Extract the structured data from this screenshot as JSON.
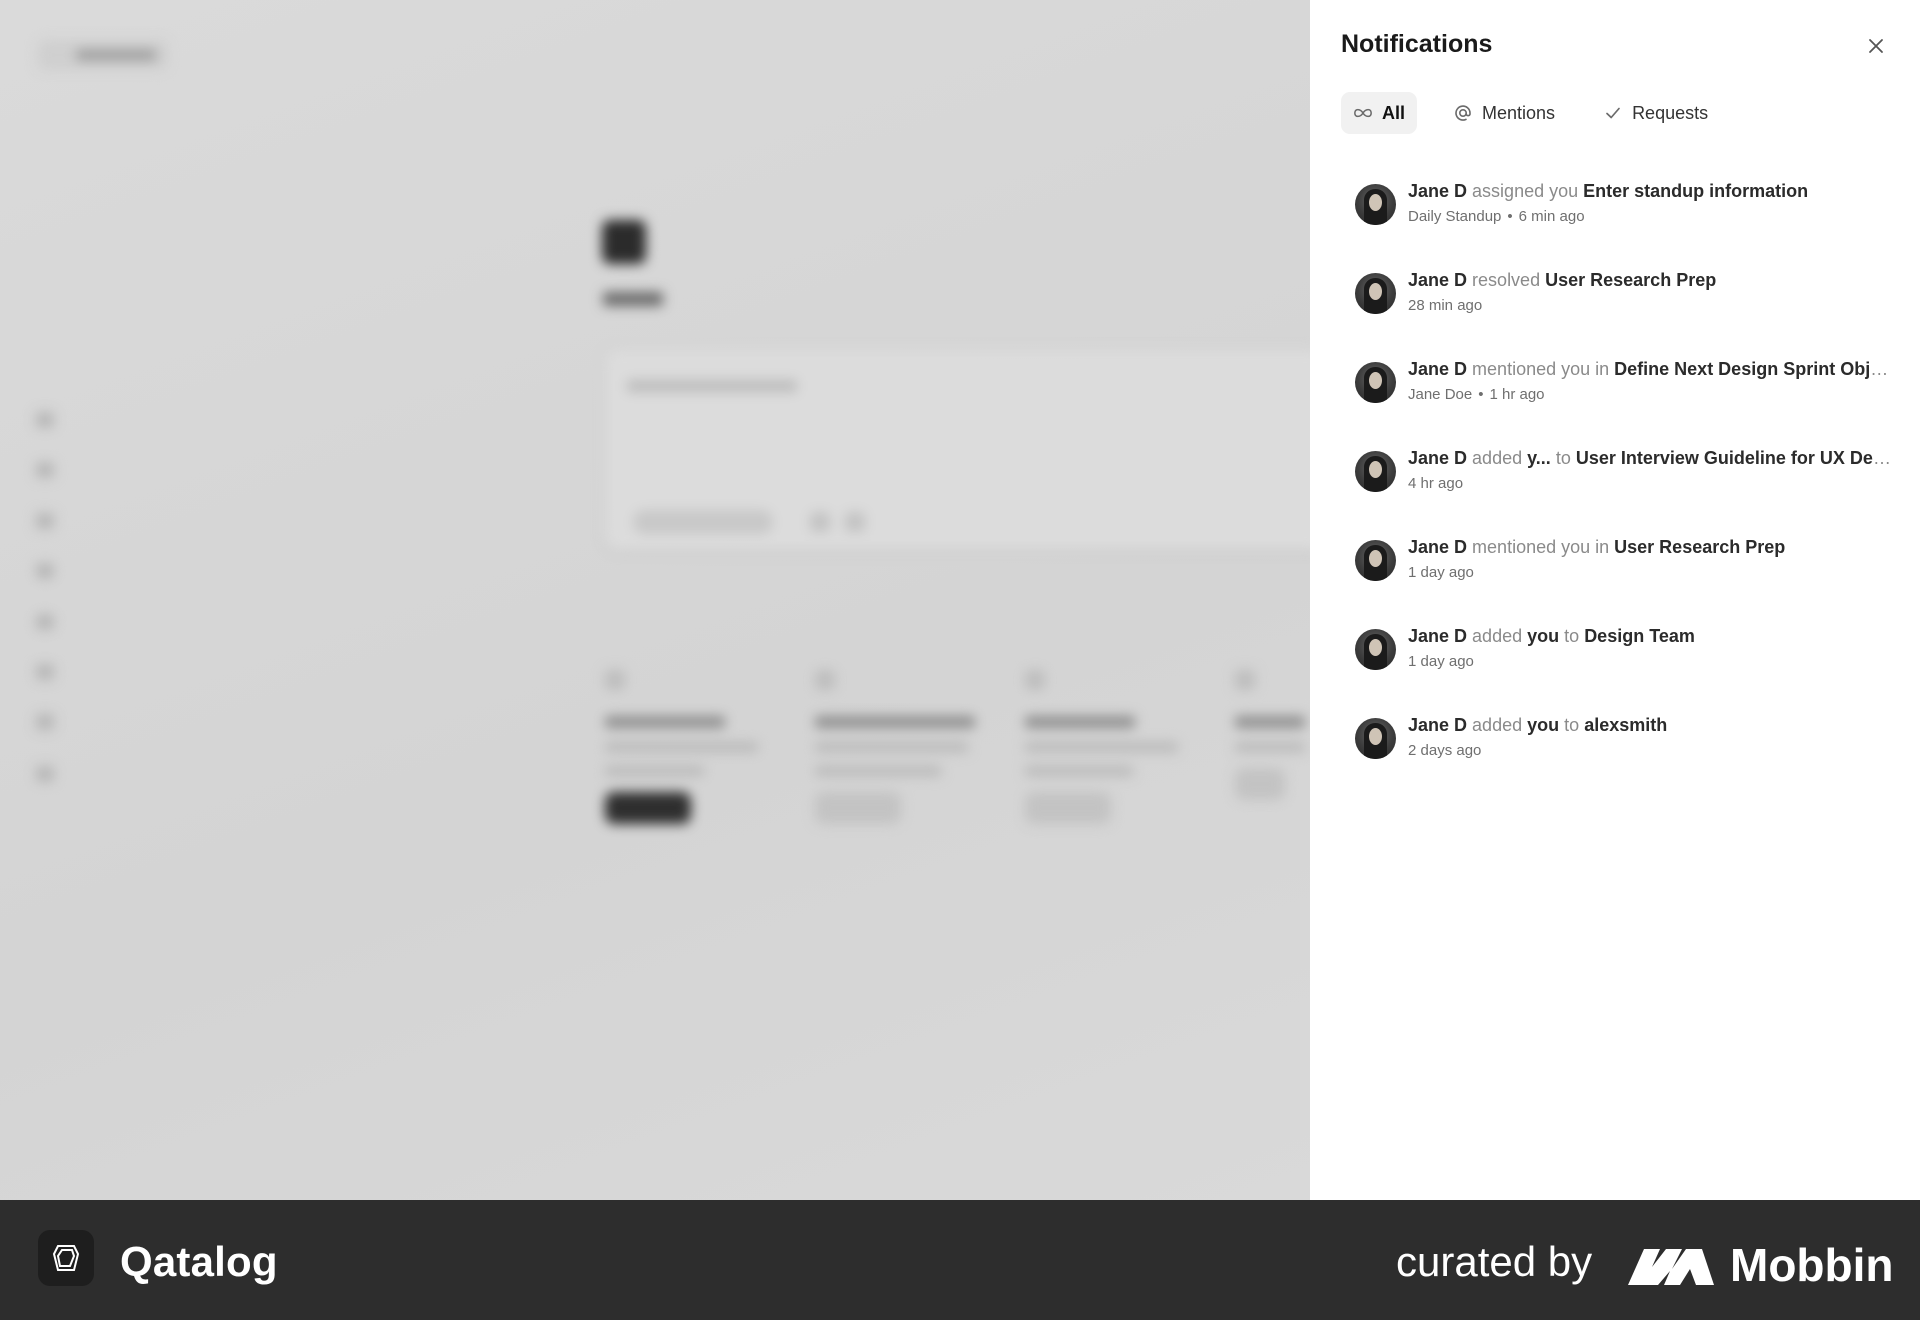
{
  "panel": {
    "title": "Notifications",
    "tabs": [
      {
        "label": "All",
        "icon": "infinity-icon",
        "active": true
      },
      {
        "label": "Mentions",
        "icon": "at-icon",
        "active": false
      },
      {
        "label": "Requests",
        "icon": "check-icon",
        "active": false
      }
    ],
    "notifications": [
      {
        "actor": "Jane D",
        "action": "assigned you",
        "sub": "",
        "pre": "",
        "target": "Enter standup information",
        "context": "Daily Standup",
        "time": "6 min ago"
      },
      {
        "actor": "Jane D",
        "action": "resolved",
        "sub": "",
        "pre": "",
        "target": "User Research Prep",
        "context": "",
        "time": "28 min ago"
      },
      {
        "actor": "Jane D",
        "action": "mentioned you in",
        "sub": "",
        "pre": "",
        "target": "Define Next Design Sprint Obje...",
        "context": "Jane Doe",
        "time": "1 hr ago"
      },
      {
        "actor": "Jane D",
        "action": "added",
        "sub": "y...",
        "pre": "to",
        "target": "User Interview Guideline for UX Desi...",
        "context": "",
        "time": "4 hr ago"
      },
      {
        "actor": "Jane D",
        "action": "mentioned you in",
        "sub": "",
        "pre": "",
        "target": "User Research Prep",
        "context": "",
        "time": "1 day ago"
      },
      {
        "actor": "Jane D",
        "action": "added",
        "sub": "you",
        "pre": "to",
        "target": "Design Team",
        "context": "",
        "time": "1 day ago"
      },
      {
        "actor": "Jane D",
        "action": "added",
        "sub": "you",
        "pre": "to",
        "target": "alexsmith",
        "context": "",
        "time": "2 days ago"
      }
    ]
  },
  "footer": {
    "app_name": "Qatalog",
    "curated_by": "curated by",
    "brand": "Mobbin"
  },
  "colors": {
    "panel_bg": "#ffffff",
    "overlay_bg": "#d9d9d9",
    "footer_bg": "#2d2d2d",
    "active_tab_bg": "#f1f1f1"
  }
}
